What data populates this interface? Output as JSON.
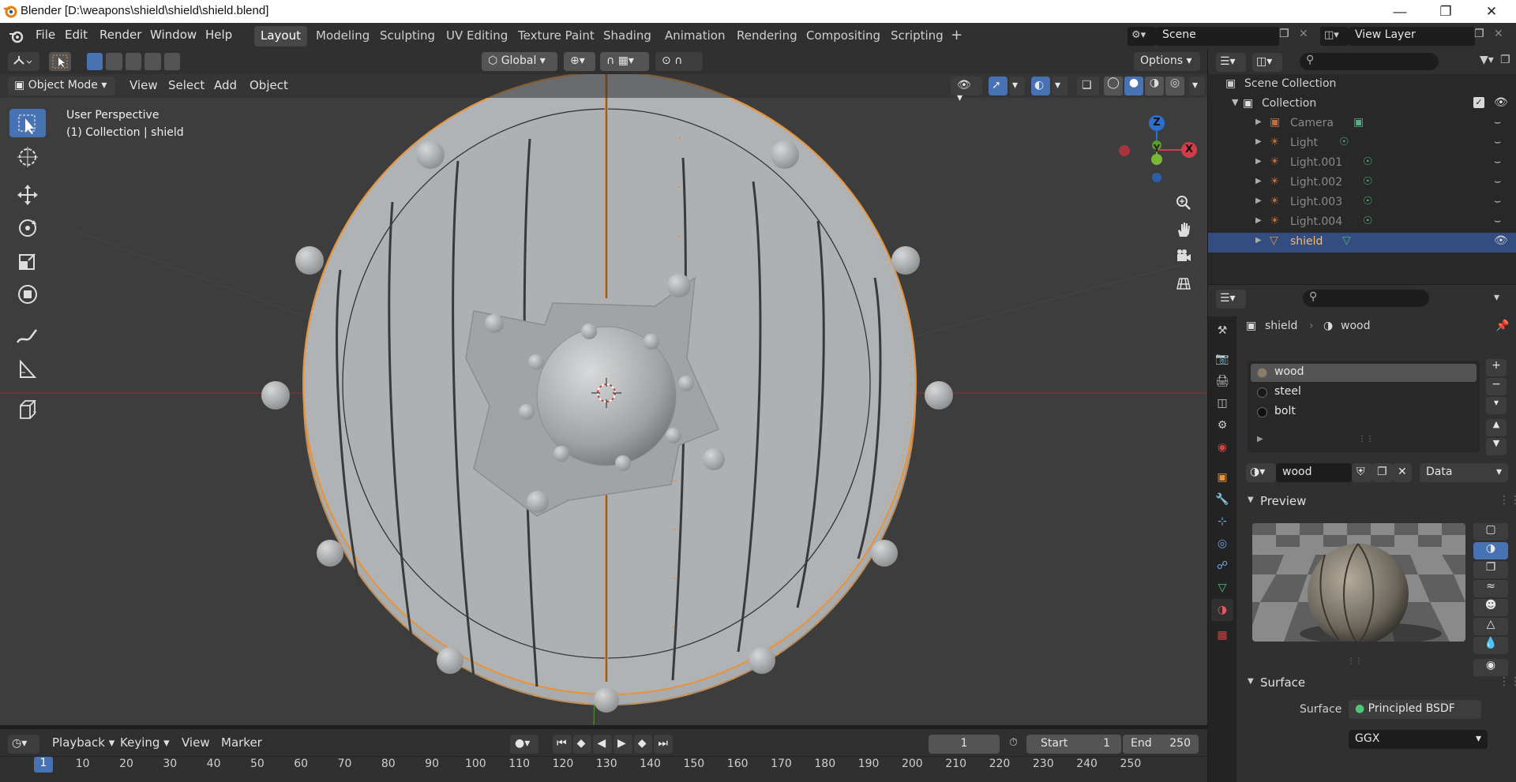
{
  "window": {
    "title": "Blender [D:\\weapons\\shield\\shield\\shield.blend]"
  },
  "menus": [
    "File",
    "Edit",
    "Render",
    "Window",
    "Help"
  ],
  "workspaces": [
    "Layout",
    "Modeling",
    "Sculpting",
    "UV Editing",
    "Texture Paint",
    "Shading",
    "Animation",
    "Rendering",
    "Compositing",
    "Scripting"
  ],
  "active_workspace": "Layout",
  "scene": {
    "name": "Scene",
    "view_layer": "View Layer"
  },
  "viewport_header": {
    "transform": "Global",
    "options": "Options"
  },
  "viewport_menu": {
    "mode": "Object Mode",
    "items": [
      "View",
      "Select",
      "Add",
      "Object"
    ]
  },
  "viewport": {
    "perspective": "User Perspective",
    "context": "(1) Collection | shield"
  },
  "gizmo": {
    "z": "Z",
    "y": "Y",
    "x": "X"
  },
  "outliner": {
    "root": "Scene Collection",
    "collection": "Collection",
    "items": [
      {
        "name": "Camera",
        "selected": false
      },
      {
        "name": "Light",
        "selected": false
      },
      {
        "name": "Light.001",
        "selected": false
      },
      {
        "name": "Light.002",
        "selected": false
      },
      {
        "name": "Light.003",
        "selected": false
      },
      {
        "name": "Light.004",
        "selected": false
      },
      {
        "name": "shield",
        "selected": true
      }
    ]
  },
  "properties": {
    "breadcrumb_object": "shield",
    "breadcrumb_material": "wood",
    "slots": [
      "wood",
      "steel",
      "bolt"
    ],
    "active_slot": "wood",
    "material_name": "wood",
    "link": "Data",
    "preview_label": "Preview",
    "surface_label": "Surface",
    "surface_field_label": "Surface",
    "surface_value": "Principled BSDF",
    "distribution": "GGX"
  },
  "timeline": {
    "menus": [
      "Playback",
      "Keying",
      "View",
      "Marker"
    ],
    "current_frame": "1",
    "start_label": "Start",
    "start": "1",
    "end_label": "End",
    "end": "250",
    "ticks": [
      "1",
      "10",
      "20",
      "30",
      "40",
      "50",
      "60",
      "70",
      "80",
      "90",
      "100",
      "110",
      "120",
      "130",
      "140",
      "150",
      "160",
      "170",
      "180",
      "190",
      "200",
      "210",
      "220",
      "230",
      "240",
      "250"
    ]
  },
  "colors": {
    "accent": "#4772b3",
    "selection_outline": "#e8923a",
    "active_row": "#334d80"
  }
}
